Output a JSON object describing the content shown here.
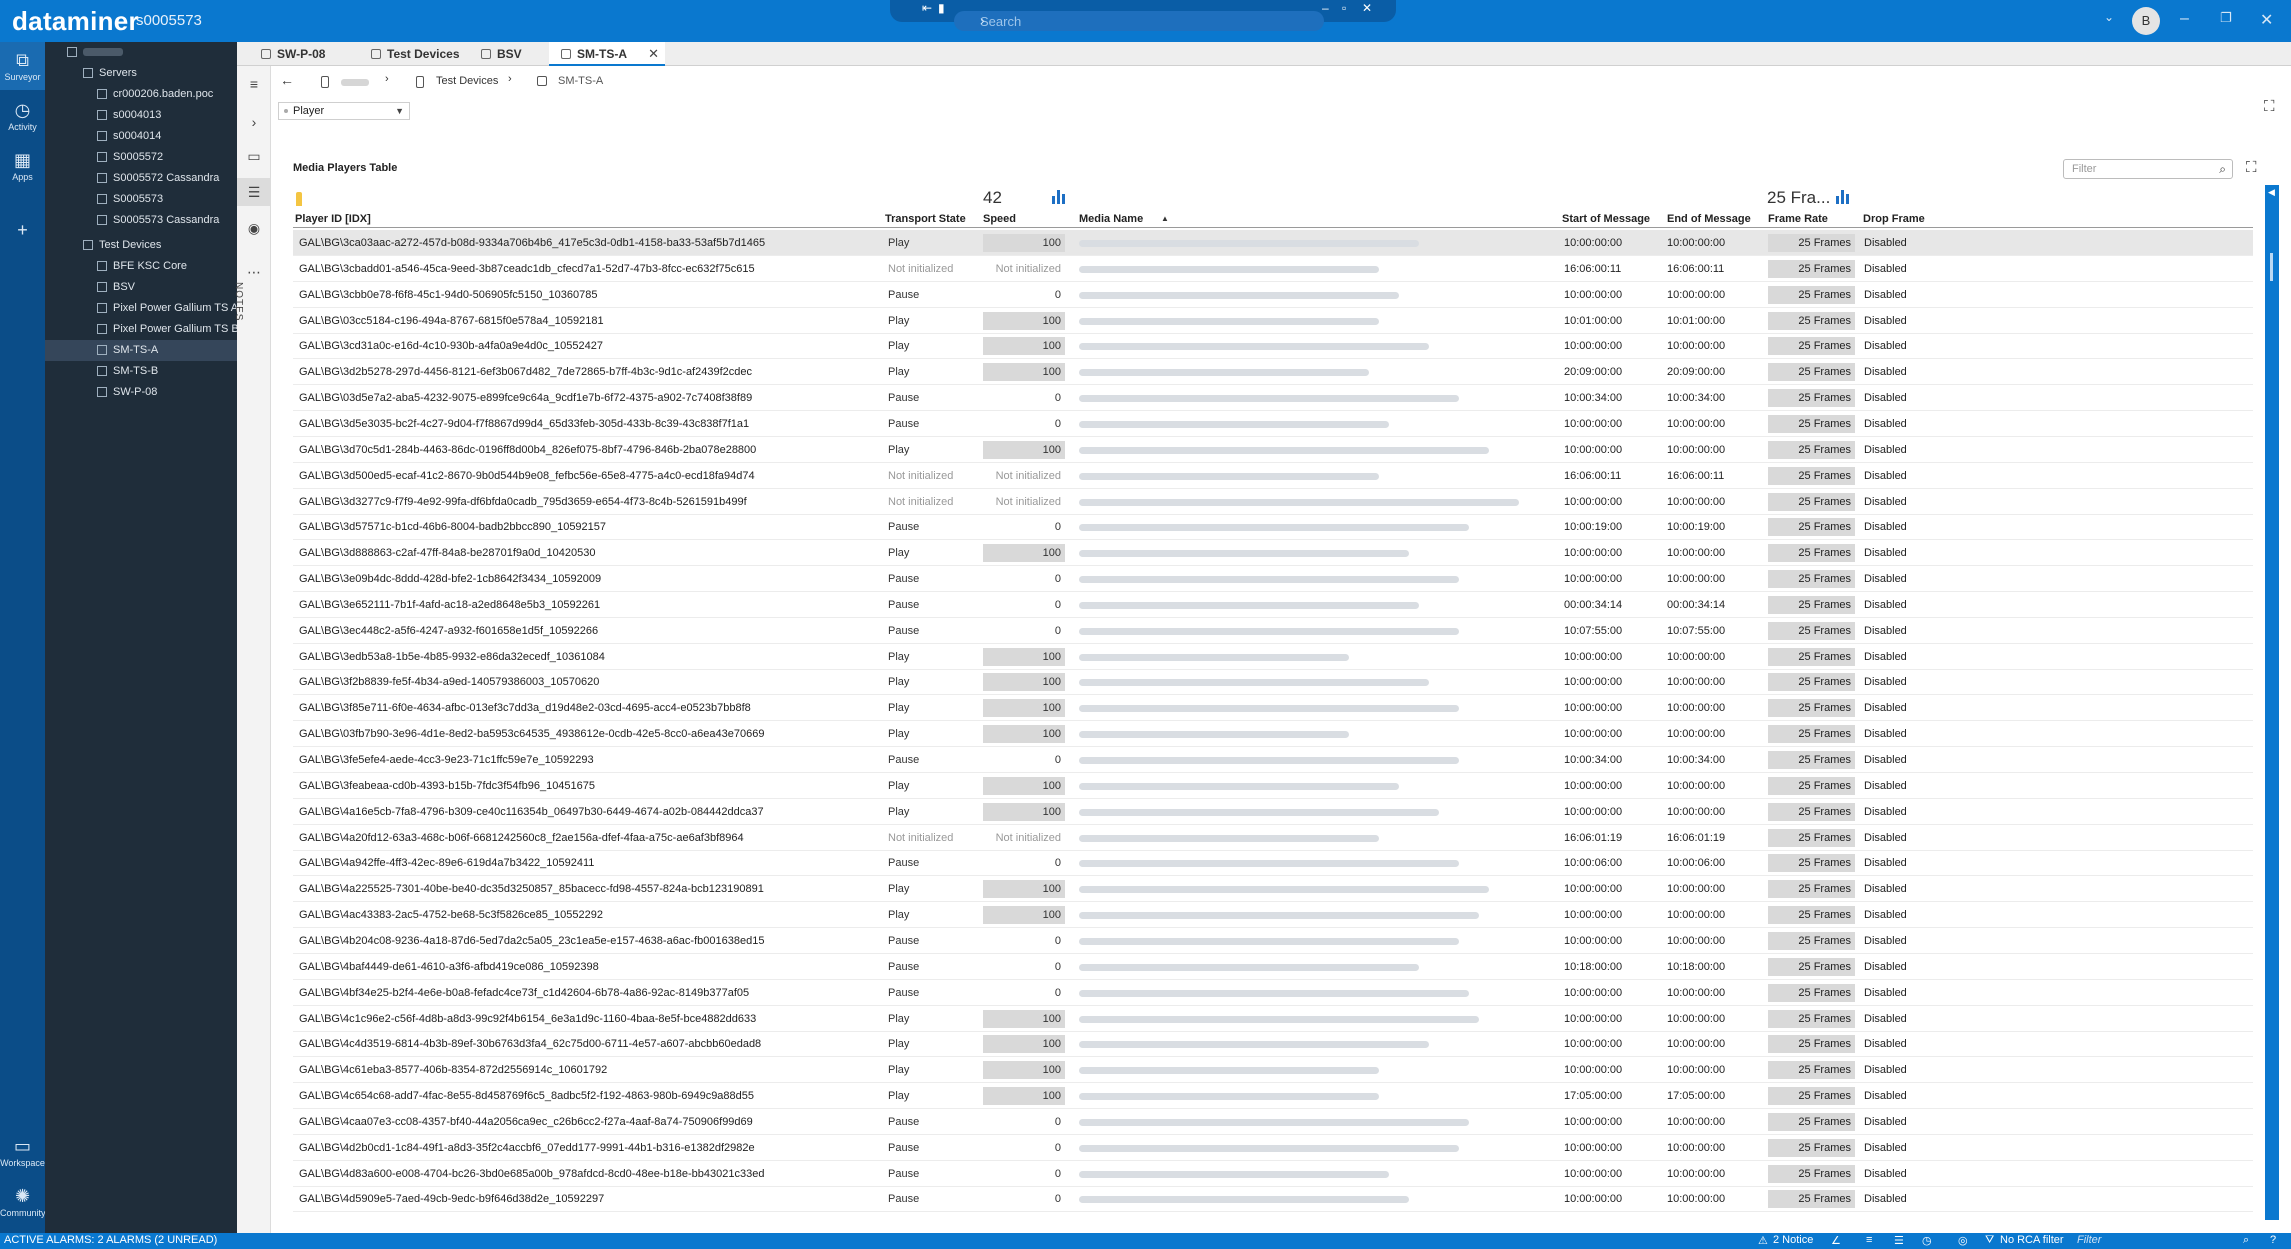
{
  "app": {
    "brand": "dataminer",
    "system_name": "s0005573",
    "search_placeholder": "Search",
    "user_initial": "B"
  },
  "rail": [
    {
      "label": "Surveyor",
      "icon": "surveyor-icon",
      "active": true
    },
    {
      "label": "Activity",
      "icon": "activity-icon"
    },
    {
      "label": "Apps",
      "icon": "apps-icon"
    },
    {
      "label": "Workspace",
      "icon": "workspace-icon"
    },
    {
      "label": "Community",
      "icon": "community-icon"
    }
  ],
  "tree": {
    "servers_label": "Servers",
    "servers": [
      "cr000206.baden.poc",
      "s0004013",
      "s0004014",
      "S0005572",
      "S0005572 Cassandra",
      "S0005573",
      "S0005573 Cassandra"
    ],
    "test_devices_label": "Test Devices",
    "test_devices": [
      "BFE KSC Core",
      "BSV",
      "Pixel Power Gallium TS A",
      "Pixel Power Gallium TS B",
      "SM-TS-A",
      "SM-TS-B",
      "SW-P-08"
    ],
    "selected": "SM-TS-A"
  },
  "tabs": [
    {
      "label": "SW-P-08"
    },
    {
      "label": "Test Devices"
    },
    {
      "label": "BSV"
    },
    {
      "label": "SM-TS-A",
      "active": true
    }
  ],
  "breadcrumb": {
    "parent": "Test Devices",
    "current": "SM-TS-A"
  },
  "page_selector": {
    "value": "Player"
  },
  "notes_label": "NOTES",
  "table": {
    "title": "Media Players Table",
    "filter_placeholder": "Filter",
    "speed_aggregate": "42",
    "frame_rate_aggregate": "25 Fra...",
    "columns": {
      "player_id": "Player ID [IDX]",
      "transport_state": "Transport State",
      "speed": "Speed",
      "media_name": "Media Name",
      "start_of_message": "Start of Message",
      "end_of_message": "End of Message",
      "frame_rate": "Frame Rate",
      "drop_frame": "Drop Frame"
    },
    "rows": [
      {
        "id": "GAL\\BG\\3ca03aac-a272-457d-b08d-9334a706b4b6_417e5c3d-0db1-4158-ba33-53af5b7d1465",
        "state": "Play",
        "speed": "100",
        "start": "10:00:00:00",
        "end": "10:00:00:00",
        "frame": "25 Frames",
        "drop": "Disabled"
      },
      {
        "id": "GAL\\BG\\3cbadd01-a546-45ca-9eed-3b87ceadc1db_cfecd7a1-52d7-47b3-8fcc-ec632f75c615",
        "state": "Not initialized",
        "speed": "Not initialized",
        "start": "16:06:00:11",
        "end": "16:06:00:11",
        "frame": "25 Frames",
        "drop": "Disabled"
      },
      {
        "id": "GAL\\BG\\3cbb0e78-f6f8-45c1-94d0-506905fc5150_10360785",
        "state": "Pause",
        "speed": "0",
        "start": "10:00:00:00",
        "end": "10:00:00:00",
        "frame": "25 Frames",
        "drop": "Disabled"
      },
      {
        "id": "GAL\\BG\\03cc5184-c196-494a-8767-6815f0e578a4_10592181",
        "state": "Play",
        "speed": "100",
        "start": "10:01:00:00",
        "end": "10:01:00:00",
        "frame": "25 Frames",
        "drop": "Disabled"
      },
      {
        "id": "GAL\\BG\\3cd31a0c-e16d-4c10-930b-a4fa0a9e4d0c_10552427",
        "state": "Play",
        "speed": "100",
        "start": "10:00:00:00",
        "end": "10:00:00:00",
        "frame": "25 Frames",
        "drop": "Disabled"
      },
      {
        "id": "GAL\\BG\\3d2b5278-297d-4456-8121-6ef3b067d482_7de72865-b7ff-4b3c-9d1c-af2439f2cdec",
        "state": "Play",
        "speed": "100",
        "start": "20:09:00:00",
        "end": "20:09:00:00",
        "frame": "25 Frames",
        "drop": "Disabled"
      },
      {
        "id": "GAL\\BG\\03d5e7a2-aba5-4232-9075-e899fce9c64a_9cdf1e7b-6f72-4375-a902-7c7408f38f89",
        "state": "Pause",
        "speed": "0",
        "start": "10:00:34:00",
        "end": "10:00:34:00",
        "frame": "25 Frames",
        "drop": "Disabled"
      },
      {
        "id": "GAL\\BG\\3d5e3035-bc2f-4c27-9d04-f7f8867d99d4_65d33feb-305d-433b-8c39-43c838f7f1a1",
        "state": "Pause",
        "speed": "0",
        "start": "10:00:00:00",
        "end": "10:00:00:00",
        "frame": "25 Frames",
        "drop": "Disabled"
      },
      {
        "id": "GAL\\BG\\3d70c5d1-284b-4463-86dc-0196ff8d00b4_826ef075-8bf7-4796-846b-2ba078e28800",
        "state": "Play",
        "speed": "100",
        "start": "10:00:00:00",
        "end": "10:00:00:00",
        "frame": "25 Frames",
        "drop": "Disabled"
      },
      {
        "id": "GAL\\BG\\3d500ed5-ecaf-41c2-8670-9b0d544b9e08_fefbc56e-65e8-4775-a4c0-ecd18fa94d74",
        "state": "Not initialized",
        "speed": "Not initialized",
        "start": "16:06:00:11",
        "end": "16:06:00:11",
        "frame": "25 Frames",
        "drop": "Disabled"
      },
      {
        "id": "GAL\\BG\\3d3277c9-f7f9-4e92-99fa-df6bfda0cadb_795d3659-e654-4f73-8c4b-5261591b499f",
        "state": "Not initialized",
        "speed": "Not initialized",
        "start": "10:00:00:00",
        "end": "10:00:00:00",
        "frame": "25 Frames",
        "drop": "Disabled"
      },
      {
        "id": "GAL\\BG\\3d57571c-b1cd-46b6-8004-badb2bbcc890_10592157",
        "state": "Pause",
        "speed": "0",
        "start": "10:00:19:00",
        "end": "10:00:19:00",
        "frame": "25 Frames",
        "drop": "Disabled"
      },
      {
        "id": "GAL\\BG\\3d888863-c2af-47ff-84a8-be28701f9a0d_10420530",
        "state": "Play",
        "speed": "100",
        "start": "10:00:00:00",
        "end": "10:00:00:00",
        "frame": "25 Frames",
        "drop": "Disabled"
      },
      {
        "id": "GAL\\BG\\3e09b4dc-8ddd-428d-bfe2-1cb8642f3434_10592009",
        "state": "Pause",
        "speed": "0",
        "start": "10:00:00:00",
        "end": "10:00:00:00",
        "frame": "25 Frames",
        "drop": "Disabled"
      },
      {
        "id": "GAL\\BG\\3e652111-7b1f-4afd-ac18-a2ed8648e5b3_10592261",
        "state": "Pause",
        "speed": "0",
        "start": "00:00:34:14",
        "end": "00:00:34:14",
        "frame": "25 Frames",
        "drop": "Disabled"
      },
      {
        "id": "GAL\\BG\\3ec448c2-a5f6-4247-a932-f601658e1d5f_10592266",
        "state": "Pause",
        "speed": "0",
        "start": "10:07:55:00",
        "end": "10:07:55:00",
        "frame": "25 Frames",
        "drop": "Disabled"
      },
      {
        "id": "GAL\\BG\\3edb53a8-1b5e-4b85-9932-e86da32ecedf_10361084",
        "state": "Play",
        "speed": "100",
        "start": "10:00:00:00",
        "end": "10:00:00:00",
        "frame": "25 Frames",
        "drop": "Disabled"
      },
      {
        "id": "GAL\\BG\\3f2b8839-fe5f-4b34-a9ed-140579386003_10570620",
        "state": "Play",
        "speed": "100",
        "start": "10:00:00:00",
        "end": "10:00:00:00",
        "frame": "25 Frames",
        "drop": "Disabled"
      },
      {
        "id": "GAL\\BG\\3f85e711-6f0e-4634-afbc-013ef3c7dd3a_d19d48e2-03cd-4695-acc4-e0523b7bb8f8",
        "state": "Play",
        "speed": "100",
        "start": "10:00:00:00",
        "end": "10:00:00:00",
        "frame": "25 Frames",
        "drop": "Disabled"
      },
      {
        "id": "GAL\\BG\\03fb7b90-3e96-4d1e-8ed2-ba5953c64535_4938612e-0cdb-42e5-8cc0-a6ea43e70669",
        "state": "Play",
        "speed": "100",
        "start": "10:00:00:00",
        "end": "10:00:00:00",
        "frame": "25 Frames",
        "drop": "Disabled"
      },
      {
        "id": "GAL\\BG\\3fe5efe4-aede-4cc3-9e23-71c1ffc59e7e_10592293",
        "state": "Pause",
        "speed": "0",
        "start": "10:00:34:00",
        "end": "10:00:34:00",
        "frame": "25 Frames",
        "drop": "Disabled"
      },
      {
        "id": "GAL\\BG\\3feabeaa-cd0b-4393-b15b-7fdc3f54fb96_10451675",
        "state": "Play",
        "speed": "100",
        "start": "10:00:00:00",
        "end": "10:00:00:00",
        "frame": "25 Frames",
        "drop": "Disabled"
      },
      {
        "id": "GAL\\BG\\4a16e5cb-7fa8-4796-b309-ce40c116354b_06497b30-6449-4674-a02b-084442ddca37",
        "state": "Play",
        "speed": "100",
        "start": "10:00:00:00",
        "end": "10:00:00:00",
        "frame": "25 Frames",
        "drop": "Disabled"
      },
      {
        "id": "GAL\\BG\\4a20fd12-63a3-468c-b06f-6681242560c8_f2ae156a-dfef-4faa-a75c-ae6af3bf8964",
        "state": "Not initialized",
        "speed": "Not initialized",
        "start": "16:06:01:19",
        "end": "16:06:01:19",
        "frame": "25 Frames",
        "drop": "Disabled"
      },
      {
        "id": "GAL\\BG\\4a942ffe-4ff3-42ec-89e6-619d4a7b3422_10592411",
        "state": "Pause",
        "speed": "0",
        "start": "10:00:06:00",
        "end": "10:00:06:00",
        "frame": "25 Frames",
        "drop": "Disabled"
      },
      {
        "id": "GAL\\BG\\4a225525-7301-40be-be40-dc35d3250857_85bacecc-fd98-4557-824a-bcb123190891",
        "state": "Play",
        "speed": "100",
        "start": "10:00:00:00",
        "end": "10:00:00:00",
        "frame": "25 Frames",
        "drop": "Disabled"
      },
      {
        "id": "GAL\\BG\\4ac43383-2ac5-4752-be68-5c3f5826ce85_10552292",
        "state": "Play",
        "speed": "100",
        "start": "10:00:00:00",
        "end": "10:00:00:00",
        "frame": "25 Frames",
        "drop": "Disabled"
      },
      {
        "id": "GAL\\BG\\4b204c08-9236-4a18-87d6-5ed7da2c5a05_23c1ea5e-e157-4638-a6ac-fb001638ed15",
        "state": "Pause",
        "speed": "0",
        "start": "10:00:00:00",
        "end": "10:00:00:00",
        "frame": "25 Frames",
        "drop": "Disabled"
      },
      {
        "id": "GAL\\BG\\4baf4449-de61-4610-a3f6-afbd419ce086_10592398",
        "state": "Pause",
        "speed": "0",
        "start": "10:18:00:00",
        "end": "10:18:00:00",
        "frame": "25 Frames",
        "drop": "Disabled"
      },
      {
        "id": "GAL\\BG\\4bf34e25-b2f4-4e6e-b0a8-fefadc4ce73f_c1d42604-6b78-4a86-92ac-8149b377af05",
        "state": "Pause",
        "speed": "0",
        "start": "10:00:00:00",
        "end": "10:00:00:00",
        "frame": "25 Frames",
        "drop": "Disabled"
      },
      {
        "id": "GAL\\BG\\4c1c96e2-c56f-4d8b-a8d3-99c92f4b6154_6e3a1d9c-1160-4baa-8e5f-bce4882dd633",
        "state": "Play",
        "speed": "100",
        "start": "10:00:00:00",
        "end": "10:00:00:00",
        "frame": "25 Frames",
        "drop": "Disabled"
      },
      {
        "id": "GAL\\BG\\4c4d3519-6814-4b3b-89ef-30b6763d3fa4_62c75d00-6711-4e57-a607-abcbb60edad8",
        "state": "Play",
        "speed": "100",
        "start": "10:00:00:00",
        "end": "10:00:00:00",
        "frame": "25 Frames",
        "drop": "Disabled"
      },
      {
        "id": "GAL\\BG\\4c61eba3-8577-406b-8354-872d2556914c_10601792",
        "state": "Play",
        "speed": "100",
        "start": "10:00:00:00",
        "end": "10:00:00:00",
        "frame": "25 Frames",
        "drop": "Disabled"
      },
      {
        "id": "GAL\\BG\\4c654c68-add7-4fac-8e55-8d458769f6c5_8adbc5f2-f192-4863-980b-6949c9a88d55",
        "state": "Play",
        "speed": "100",
        "start": "17:05:00:00",
        "end": "17:05:00:00",
        "frame": "25 Frames",
        "drop": "Disabled"
      },
      {
        "id": "GAL\\BG\\4caa07e3-cc08-4357-bf40-44a2056ca9ec_c26b6cc2-f27a-4aaf-8a74-750906f99d69",
        "state": "Pause",
        "speed": "0",
        "start": "10:00:00:00",
        "end": "10:00:00:00",
        "frame": "25 Frames",
        "drop": "Disabled"
      },
      {
        "id": "GAL\\BG\\4d2b0cd1-1c84-49f1-a8d3-35f2c4accbf6_07edd177-9991-44b1-b316-e1382df2982e",
        "state": "Pause",
        "speed": "0",
        "start": "10:00:00:00",
        "end": "10:00:00:00",
        "frame": "25 Frames",
        "drop": "Disabled"
      },
      {
        "id": "GAL\\BG\\4d83a600-e008-4704-bc26-3bd0e685a00b_978afdcd-8cd0-48ee-b18e-bb43021c33ed",
        "state": "Pause",
        "speed": "0",
        "start": "10:00:00:00",
        "end": "10:00:00:00",
        "frame": "25 Frames",
        "drop": "Disabled"
      },
      {
        "id": "GAL\\BG\\4d5909e5-7aed-49cb-9edc-b9f646d38d2e_10592297",
        "state": "Pause",
        "speed": "0",
        "start": "10:00:00:00",
        "end": "10:00:00:00",
        "frame": "25 Frames",
        "drop": "Disabled"
      }
    ]
  },
  "statusbar": {
    "alarms": "ACTIVE ALARMS: 2 ALARMS (2 UNREAD)",
    "notice": "2 Notice",
    "rca_filter": "No RCA filter",
    "filter_placeholder": "Filter"
  },
  "colors": {
    "accent": "#0a78cf",
    "rail": "#0b4d88",
    "tree_bg": "#1f2d3a"
  }
}
